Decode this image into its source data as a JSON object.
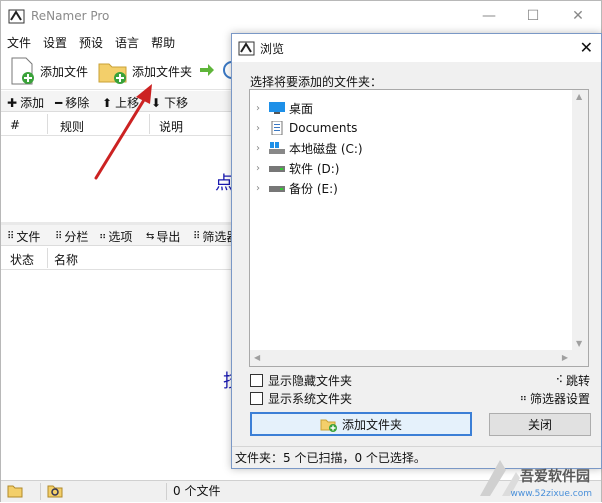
{
  "app": {
    "title": "ReNamer Pro",
    "window_controls": {
      "minimize": "—",
      "maximize": "☐",
      "close": "✕"
    },
    "menu": [
      "文件",
      "设置",
      "预设",
      "语言",
      "帮助"
    ],
    "toolbar": {
      "add_files": "添加文件",
      "add_folder": "添加文件夹"
    },
    "rules_bar": {
      "add": "添加",
      "remove": "移除",
      "up": "上移",
      "down": "下移"
    },
    "rules_columns": [
      "#",
      "规则",
      "说明"
    ],
    "rules_hint": "点",
    "files_hint": "技",
    "files_bar": {
      "files": "文件",
      "columns": "分栏",
      "options": "选项",
      "export": "导出",
      "filter": "筛选器"
    },
    "files_columns": [
      "状态",
      "名称"
    ],
    "status": {
      "file_count": "0 个文件"
    }
  },
  "dialog": {
    "title": "浏览",
    "prompt": "选择将要添加的文件夹：",
    "tree": [
      {
        "label": "桌面",
        "icon": "desktop-icon"
      },
      {
        "label": "Documents",
        "icon": "documents-icon"
      },
      {
        "label": "本地磁盘 (C:)",
        "icon": "windows-drive-icon"
      },
      {
        "label": "软件 (D:)",
        "icon": "drive-icon"
      },
      {
        "label": "备份 (E:)",
        "icon": "drive-icon"
      }
    ],
    "show_hidden": "显示隐藏文件夹",
    "show_system": "显示系统文件夹",
    "jump": "跳转",
    "filter_settings": "筛选器设置",
    "add_folder_button": "添加文件夹",
    "close_button": "关闭",
    "status": "文件夹：5 个已扫描，0 个已选择。"
  },
  "watermark": {
    "name": "吾爱软件园",
    "url": "www.52zixue.com"
  },
  "colors": {
    "arrow": "#cc2222",
    "hint_text": "#1a1ab0",
    "dialog_border": "#7a98c6",
    "primary_button": "#3c7fd6"
  }
}
